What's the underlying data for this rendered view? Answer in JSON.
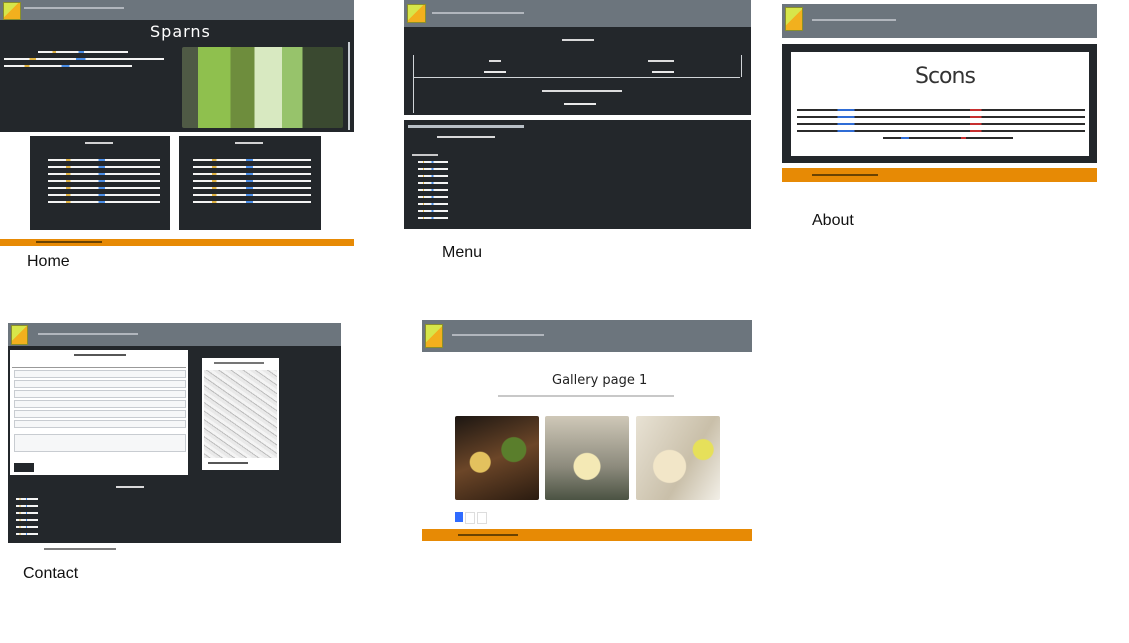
{
  "captions": {
    "home": "Home",
    "menu": "Menu",
    "about": "About",
    "contact": "Contact"
  },
  "home": {
    "title": "Sparns"
  },
  "about": {
    "title": "Scons"
  },
  "gallery": {
    "title": "Gallery page 1"
  },
  "colors": {
    "navbar": "#6c757d",
    "dark": "#23272b",
    "footer": "#e78a05",
    "active_page": "#2f6bff"
  }
}
